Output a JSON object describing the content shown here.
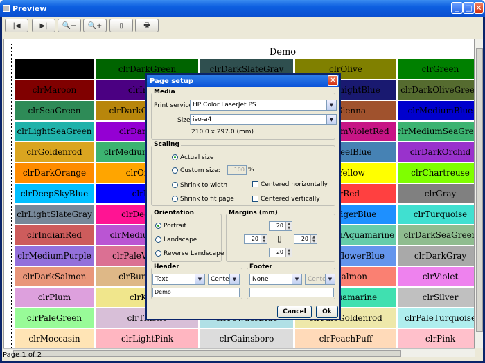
{
  "window": {
    "title": "Preview",
    "minimize": "_",
    "maximize": "□",
    "close": "✕"
  },
  "toolbar": {
    "buttons": [
      "first-page",
      "next-page",
      "zoom-out",
      "zoom-in",
      "page-setup",
      "print"
    ]
  },
  "preview": {
    "title": "Demo",
    "status": "Page 1 of 2",
    "columns": [
      {
        "w": 115
      },
      {
        "w": 147
      },
      {
        "w": 134
      },
      {
        "w": 146
      },
      {
        "w": 121
      }
    ],
    "rows": [
      [
        {
          "t": "",
          "bg": "#000000",
          "fg": "#000"
        },
        {
          "t": "clrDarkGreen",
          "bg": "#006400",
          "fg": "#000"
        },
        {
          "t": "clrDarkSlateGray",
          "bg": "#2f4f4f",
          "fg": "#000"
        },
        {
          "t": "clrOlive",
          "bg": "#808000",
          "fg": "#000"
        },
        {
          "t": "clrGreen",
          "bg": "#008000",
          "fg": "#000"
        }
      ],
      [
        {
          "t": "clrMaroon",
          "bg": "#800000",
          "fg": "#000"
        },
        {
          "t": "clrIndigo",
          "bg": "#4b0082",
          "fg": "#000"
        },
        {
          "t": "",
          "bg": "#4169e1",
          "fg": "#000"
        },
        {
          "t": "clrMidnightBlue",
          "bg": "#191970",
          "fg": "#000"
        },
        {
          "t": "clrDarkOliveGreen",
          "bg": "#556b2f",
          "fg": "#000"
        }
      ],
      [
        {
          "t": "clrSeaGreen",
          "bg": "#2e8b57",
          "fg": "#000"
        },
        {
          "t": "clrDarkGoldenrod",
          "bg": "#b8860b",
          "fg": "#000"
        },
        {
          "t": "",
          "bg": "#8b4513",
          "fg": "#000"
        },
        {
          "t": "clrSienna",
          "bg": "#a0522d",
          "fg": "#000"
        },
        {
          "t": "clrMediumBlue",
          "bg": "#0000cd",
          "fg": "#000"
        }
      ],
      [
        {
          "t": "clrLightSeaGreen",
          "bg": "#20b2aa",
          "fg": "#000"
        },
        {
          "t": "clrDarkViolet",
          "bg": "#9400d3",
          "fg": "#000"
        },
        {
          "t": "",
          "bg": "#c71585",
          "fg": "#000"
        },
        {
          "t": "clrMediumVioletRed",
          "bg": "#c71585",
          "fg": "#000"
        },
        {
          "t": "clrMediumSeaGreen",
          "bg": "#3cb371",
          "fg": "#000"
        }
      ],
      [
        {
          "t": "clrGoldenrod",
          "bg": "#daa520",
          "fg": "#000"
        },
        {
          "t": "clrMediumSlateBlue",
          "bg": "#3cb371",
          "fg": "#000"
        },
        {
          "t": "",
          "bg": "#4682b4",
          "fg": "#000"
        },
        {
          "t": "clrSteelBlue",
          "bg": "#4682b4",
          "fg": "#000"
        },
        {
          "t": "clrDarkOrchid",
          "bg": "#9932cc",
          "fg": "#000"
        }
      ],
      [
        {
          "t": "clrDarkOrange",
          "bg": "#ff8c00",
          "fg": "#000"
        },
        {
          "t": "clrOrange",
          "bg": "#ffa500",
          "fg": "#000"
        },
        {
          "t": "",
          "bg": "#ffd700",
          "fg": "#000"
        },
        {
          "t": "clrYellow",
          "bg": "#ffff00",
          "fg": "#000"
        },
        {
          "t": "clrChartreuse",
          "bg": "#7fff00",
          "fg": "#000"
        }
      ],
      [
        {
          "t": "clrDeepSkyBlue",
          "bg": "#00bfff",
          "fg": "#000"
        },
        {
          "t": "clrBlue",
          "bg": "#0000ff",
          "fg": "#000"
        },
        {
          "t": "",
          "bg": "#ff0000",
          "fg": "#000"
        },
        {
          "t": "clrRed",
          "bg": "#ff4040",
          "fg": "#000"
        },
        {
          "t": "clrGray",
          "bg": "#808080",
          "fg": "#000"
        }
      ],
      [
        {
          "t": "clrLightSlateGray",
          "bg": "#778899",
          "fg": "#000"
        },
        {
          "t": "clrDeepPink",
          "bg": "#ff1493",
          "fg": "#000"
        },
        {
          "t": "",
          "bg": "#1e90ff",
          "fg": "#000"
        },
        {
          "t": "clrDodgerBlue",
          "bg": "#1e90ff",
          "fg": "#000"
        },
        {
          "t": "clrTurquoise",
          "bg": "#40e0d0",
          "fg": "#000"
        }
      ],
      [
        {
          "t": "clrIndianRed",
          "bg": "#cd5c5c",
          "fg": "#000"
        },
        {
          "t": "clrMediumOrchid",
          "bg": "#ba55d3",
          "fg": "#000"
        },
        {
          "t": "",
          "bg": "#66cdaa",
          "fg": "#000"
        },
        {
          "t": "clrMediumAquamarine",
          "bg": "#66cdaa",
          "fg": "#000"
        },
        {
          "t": "clrDarkSeaGreen",
          "bg": "#8fbc8f",
          "fg": "#000"
        }
      ],
      [
        {
          "t": "clrMediumPurple",
          "bg": "#9370db",
          "fg": "#000"
        },
        {
          "t": "clrPaleVioletRed",
          "bg": "#db7093",
          "fg": "#000"
        },
        {
          "t": "",
          "bg": "#6495ed",
          "fg": "#000"
        },
        {
          "t": "clrCornflowerBlue",
          "bg": "#6495ed",
          "fg": "#000"
        },
        {
          "t": "clrDarkGray",
          "bg": "#a9a9a9",
          "fg": "#000"
        }
      ],
      [
        {
          "t": "clrDarkSalmon",
          "bg": "#e9967a",
          "fg": "#000"
        },
        {
          "t": "clrBurlyWood",
          "bg": "#deb887",
          "fg": "#000"
        },
        {
          "t": "",
          "bg": "#fa8072",
          "fg": "#000"
        },
        {
          "t": "clrSalmon",
          "bg": "#fa8072",
          "fg": "#000"
        },
        {
          "t": "clrViolet",
          "bg": "#ee82ee",
          "fg": "#000"
        }
      ],
      [
        {
          "t": "clrPlum",
          "bg": "#dda0dd",
          "fg": "#000"
        },
        {
          "t": "clrKhaki",
          "bg": "#f0e68c",
          "fg": "#000"
        },
        {
          "t": "",
          "bg": "#7fffd4",
          "fg": "#000"
        },
        {
          "t": "clrAquamarine",
          "bg": "#40e0b0",
          "fg": "#000"
        },
        {
          "t": "clrSilver",
          "bg": "#c0c0c0",
          "fg": "#000"
        }
      ],
      [
        {
          "t": "clrPaleGreen",
          "bg": "#98fb98",
          "fg": "#000"
        },
        {
          "t": "clrThistle",
          "bg": "#d8bfd8",
          "fg": "#000"
        },
        {
          "t": "clrPowderBlue",
          "bg": "#b0e0e6",
          "fg": "#000"
        },
        {
          "t": "clrPaleGoldenrod",
          "bg": "#eee8aa",
          "fg": "#000"
        },
        {
          "t": "clrPaleTurquoise",
          "bg": "#afeeee",
          "fg": "#000"
        }
      ],
      [
        {
          "t": "clrMoccasin",
          "bg": "#ffe4b5",
          "fg": "#000"
        },
        {
          "t": "clrLightPink",
          "bg": "#ffb6c1",
          "fg": "#000"
        },
        {
          "t": "clrGainsboro",
          "bg": "#dcdcdc",
          "fg": "#000"
        },
        {
          "t": "clrPeachPuff",
          "bg": "#ffdab9",
          "fg": "#000"
        },
        {
          "t": "clrPink",
          "bg": "#ffc0cb",
          "fg": "#000"
        }
      ]
    ]
  },
  "dialog": {
    "title": "Page setup",
    "media": {
      "label": "Media",
      "service_label": "Print service:",
      "service": "HP Color LaserJet PS",
      "size_label": "Size:",
      "size": "iso-a4",
      "dims": "210.0 x 297.0 (mm)"
    },
    "scaling": {
      "label": "Scaling",
      "actual": "Actual size",
      "custom": "Custom size:",
      "custom_value": "100",
      "pct": "%",
      "shrink_width": "Shrink to width",
      "shrink_fit": "Shrink to fit page",
      "center_h": "Centered horizontally",
      "center_v": "Centered vertically"
    },
    "orientation": {
      "label": "Orientation",
      "portrait": "Portrait",
      "landscape": "Landscape",
      "reverse": "Reverse Landscape"
    },
    "margins": {
      "label": "Margins (mm)",
      "top": "20",
      "left": "20",
      "right": "20",
      "bottom": "20"
    },
    "header": {
      "label": "Header",
      "type": "Text",
      "align": "Center",
      "text": "Demo"
    },
    "footer": {
      "label": "Footer",
      "type": "None",
      "align": "Center",
      "text": ""
    },
    "cancel": "Cancel",
    "ok": "Ok"
  }
}
